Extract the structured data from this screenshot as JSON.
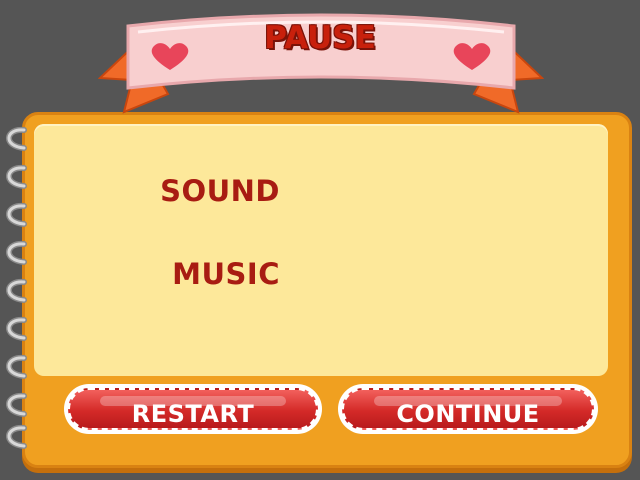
{
  "dialog": {
    "title": "PAUSE",
    "options": {
      "sound_label": "SOUND",
      "music_label": "MUSIC"
    },
    "buttons": {
      "restart_label": "RESTART",
      "continue_label": "CONTINUE"
    }
  },
  "colors": {
    "background": "#555555",
    "frame": "#f0a020",
    "paper": "#fde89a",
    "ribbon": "#f8cfcf",
    "ribbon_tail": "#f06a28",
    "title_text": "#c8200c",
    "label_text": "#a81c12",
    "button": "#d42a28",
    "heart": "#e8455a"
  },
  "icons": [
    "heart-icon",
    "spiral-ring-icon"
  ]
}
